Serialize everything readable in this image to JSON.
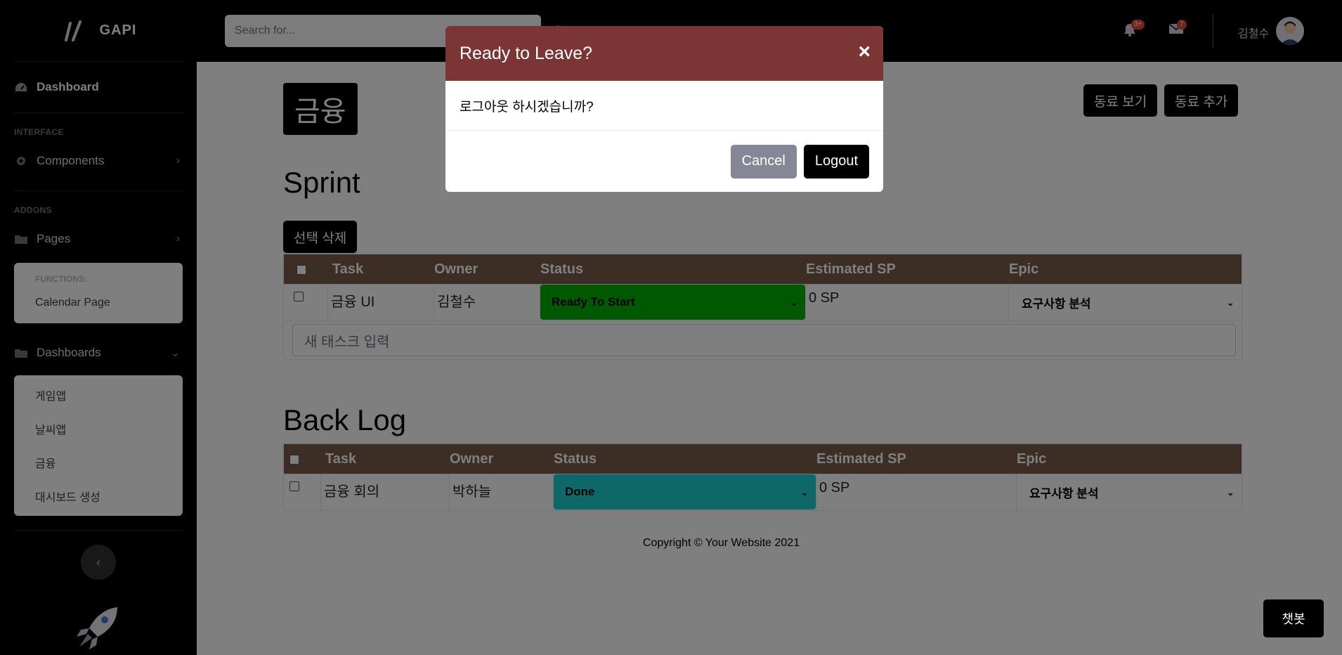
{
  "brand": {
    "name": "GAPI"
  },
  "sidebar": {
    "dashboard": "Dashboard",
    "heading_interface": "INTERFACE",
    "components": "Components",
    "heading_addons": "ADDONS",
    "pages": "Pages",
    "functions_heading": "FUNCTIONS:",
    "calendar_page": "Calendar Page",
    "dashboards": "Dashboards",
    "dashboards_items": [
      "게임앱",
      "날씨앱",
      "금융",
      "대시보드 생성"
    ]
  },
  "topbar": {
    "search_placeholder": "Search for...",
    "alerts_badge": "3+",
    "messages_badge": "7",
    "user_name": "김철수"
  },
  "main": {
    "page_title": "금융",
    "view_colleagues": "동료 보기",
    "add_colleague": "동료 추가",
    "sprint_title": "Sprint",
    "delete_selected": "선택 삭제",
    "backlog_title": "Back Log",
    "columns": [
      "Task",
      "Owner",
      "Status",
      "Estimated SP",
      "Epic"
    ],
    "sprint_rows": [
      {
        "task": "금융 UI",
        "owner": "김철수",
        "status": "Ready To Start",
        "sp": "0 SP",
        "epic": "요구사항 분석"
      }
    ],
    "new_task_placeholder": "새 태스크 입력",
    "backlog_rows": [
      {
        "task": "금융 회의",
        "owner": "박하늘",
        "status": "Done",
        "sp": "0 SP",
        "epic": "요구사항 분석"
      }
    ],
    "copyright": "Copyright © Your Website 2021",
    "chatbot": "챗봇"
  },
  "modal": {
    "title": "Ready to Leave?",
    "close": "×",
    "body": "로그아웃 하시겠습니까?",
    "cancel": "Cancel",
    "logout": "Logout"
  },
  "colors": {
    "status_ready": "#00b300",
    "status_done": "#1ccfd0",
    "modal_header": "#7c3535"
  }
}
